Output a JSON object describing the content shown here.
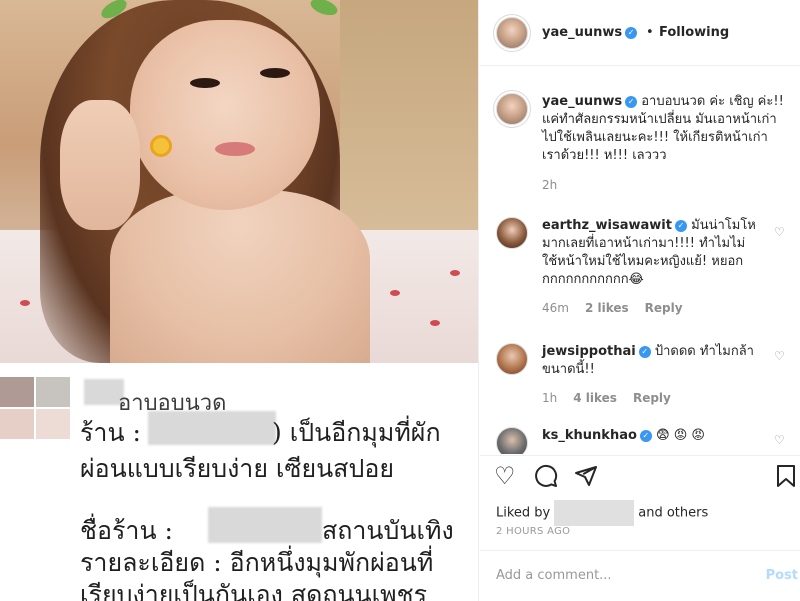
{
  "header": {
    "username": "yae_uunws",
    "separator": "•",
    "following_label": "Following"
  },
  "caption": {
    "username": "yae_uunws",
    "text_line1": "อาบอบนวด ค่ะ เชิญ ค่ะ!!",
    "text_line2": "แค่ทำศัลยกรรมหน้าเปลี่ยน มันเอาหน้าเก่า",
    "text_line3": "ไปใช้เพลินเลยนะคะ!!! ให้เกียรติหน้าเก่า",
    "text_line4": "เราด้วย!!! ห!!! เลววว",
    "time": "2h"
  },
  "comments": [
    {
      "username": "earthz_wisawawit",
      "line1": "มันน่าโมโห",
      "line2": "มากเลยที่เอาหน้าเก่ามา!!!! ทำไมไม่",
      "line3": "ใช้หน้าใหม่ใช้ไหมคะหญิงแย้! หยอก",
      "line4": "กกกกกกกกกกก😂",
      "time": "46m",
      "likes": "2 likes",
      "reply": "Reply"
    },
    {
      "username": "jewsippothai",
      "line1": "ป้าดดด ทำไมกล้า",
      "line2": "ขนาดนี้!!",
      "time": "1h",
      "likes": "4 likes",
      "reply": "Reply"
    },
    {
      "username": "ks_khunkhao",
      "line1": "😨 😡 😡"
    }
  ],
  "actions": {
    "liked_by_prefix": "Liked by",
    "liked_by_suffix": "and others",
    "timestamp": "2 HOURS AGO"
  },
  "add_comment": {
    "placeholder": "Add a comment...",
    "post_label": "Post"
  },
  "media_text": {
    "title": "อาบอบนวด",
    "line1_a": "ร้าน :",
    "line1_b": ") เป็นอีกมุมที่ผัก",
    "line2": "ผ่อนแบบเรียบง่าย เซียนสปอย",
    "line3_a": "ชื่อร้าน :",
    "line3_b": "สถานบันเทิง",
    "line4": "รายละเอียด : อีกหนึ่งมุมพักผ่อนที่",
    "line5": "เรียบง่ายเป็นกันเอง สดถนนเพชร"
  },
  "colors": {
    "verified": "#3897f0",
    "meta_gray": "#8e8e8e",
    "post_button": "#b3dbff",
    "border": "#efefef"
  },
  "icons": [
    "heart-icon",
    "comment-icon",
    "share-icon",
    "bookmark-icon",
    "verified-badge-icon"
  ]
}
